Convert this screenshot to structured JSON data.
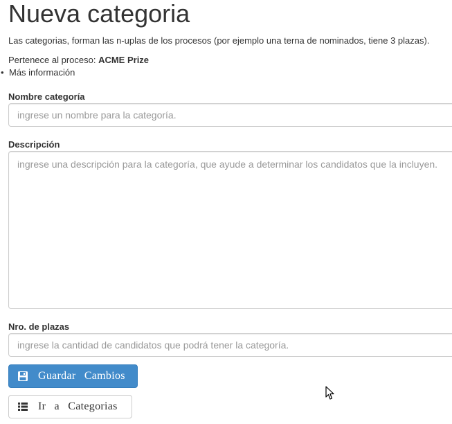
{
  "page": {
    "title": "Nueva categoria",
    "intro": "Las categorias, forman las n-uplas de los procesos (por ejemplo una terna de nominados, tiene 3 plazas).",
    "process_prefix": "Pertenece al proceso: ",
    "process_name": "ACME Prize",
    "more_info_bullet": "•",
    "more_info": "Más información"
  },
  "form": {
    "name": {
      "label": "Nombre categoría",
      "placeholder": "ingrese un nombre para la categoría.",
      "value": ""
    },
    "description": {
      "label": "Descripción",
      "placeholder": "ingrese una descripción para la categoría, que ayude a determinar los candidatos que la incluyen.",
      "value": ""
    },
    "slots": {
      "label": "Nro. de plazas",
      "placeholder": "ingrese la cantidad de candidatos que podrá tener la categoría.",
      "value": ""
    }
  },
  "buttons": {
    "save": {
      "label": "Guardar Cambios",
      "icon": "floppy-disk-icon"
    },
    "back": {
      "label": "Ir a Categorias",
      "icon": "list-icon"
    }
  },
  "colors": {
    "primary": "#428bca",
    "primary_border": "#357ebd",
    "input_border": "#cccccc",
    "placeholder": "#999999",
    "text": "#333333"
  }
}
